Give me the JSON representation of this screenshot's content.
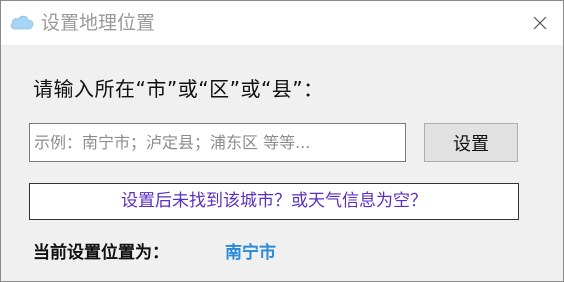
{
  "window": {
    "title": "设置地理位置",
    "icon": "cloud-icon",
    "close_icon": "close-icon"
  },
  "form": {
    "prompt": "请输入所在“市”或“区”或“县”：",
    "input_value": "",
    "input_placeholder": "示例：南宁市；泸定县；浦东区 等等...",
    "set_button_label": "设置",
    "help_link": "设置后未找到该城市？或天气信息为空？"
  },
  "current": {
    "label": "当前设置位置为：",
    "value": "南宁市"
  },
  "colors": {
    "title_text": "#9a9a9a",
    "cloud_icon": "#a8d4f5",
    "help_link_text": "#5a2fc2",
    "current_value": "#2a8ad6",
    "window_bg": "#f0f0f0"
  }
}
